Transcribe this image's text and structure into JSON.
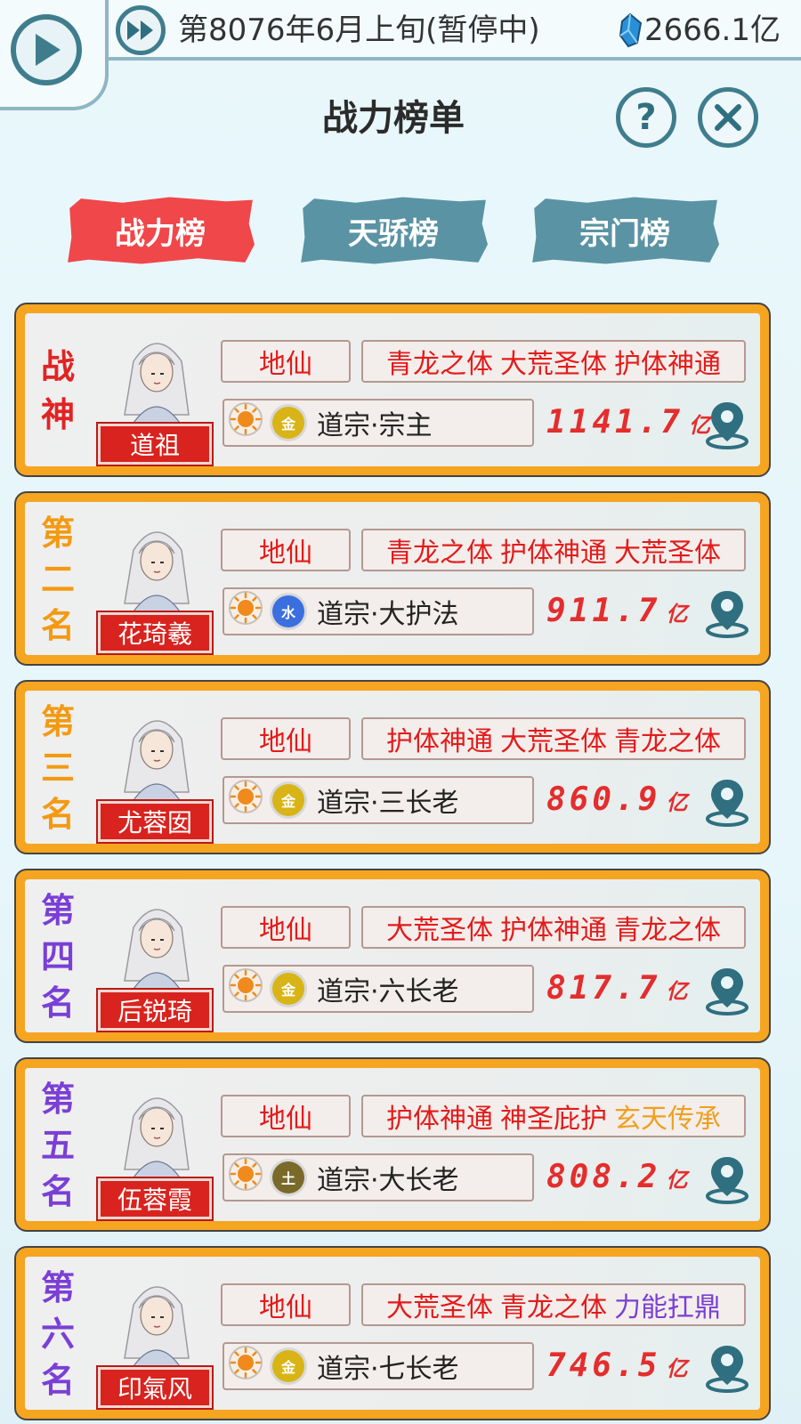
{
  "header": {
    "date": "第8076年6月上旬(暂停中)",
    "currency": "2666.1亿",
    "title": "战力榜单"
  },
  "tabs": [
    {
      "label": "战力榜",
      "active": true
    },
    {
      "label": "天骄榜",
      "active": false
    },
    {
      "label": "宗门榜",
      "active": false
    }
  ],
  "colors": {
    "gold_rank": "#f6a521",
    "purple_rank": "#7a3fd6",
    "red": "#e31b1b",
    "teal": "#3f7d8d"
  },
  "entries": [
    {
      "rank": [
        "战",
        "神"
      ],
      "rank_color": "#e02424",
      "name": "道祖",
      "realm": "地仙",
      "traits": [
        {
          "text": "青龙之体",
          "color": "#e31b1b"
        },
        {
          "text": "大荒圣体",
          "color": "#e31b1b"
        },
        {
          "text": "护体神通",
          "color": "#e31b1b"
        }
      ],
      "element": "金",
      "element_color": "#d9b416",
      "role": "道宗·宗主",
      "power": "1141.7",
      "unit": "亿"
    },
    {
      "rank": [
        "第",
        "二",
        "名"
      ],
      "rank_color": "#f39a12",
      "name": "花琦羲",
      "realm": "地仙",
      "traits": [
        {
          "text": "青龙之体",
          "color": "#e31b1b"
        },
        {
          "text": "护体神通",
          "color": "#e31b1b"
        },
        {
          "text": "大荒圣体",
          "color": "#e31b1b"
        }
      ],
      "element": "水",
      "element_color": "#3b6fe0",
      "role": "道宗·大护法",
      "power": "911.7",
      "unit": "亿"
    },
    {
      "rank": [
        "第",
        "三",
        "名"
      ],
      "rank_color": "#f39a12",
      "name": "尤蓉囡",
      "realm": "地仙",
      "traits": [
        {
          "text": "护体神通",
          "color": "#e31b1b"
        },
        {
          "text": "大荒圣体",
          "color": "#e31b1b"
        },
        {
          "text": "青龙之体",
          "color": "#e31b1b"
        }
      ],
      "element": "金",
      "element_color": "#d9b416",
      "role": "道宗·三长老",
      "power": "860.9",
      "unit": "亿"
    },
    {
      "rank": [
        "第",
        "四",
        "名"
      ],
      "rank_color": "#7a3fd6",
      "name": "后锐琦",
      "realm": "地仙",
      "traits": [
        {
          "text": "大荒圣体",
          "color": "#e31b1b"
        },
        {
          "text": "护体神通",
          "color": "#e31b1b"
        },
        {
          "text": "青龙之体",
          "color": "#e31b1b"
        }
      ],
      "element": "金",
      "element_color": "#d9b416",
      "role": "道宗·六长老",
      "power": "817.7",
      "unit": "亿"
    },
    {
      "rank": [
        "第",
        "五",
        "名"
      ],
      "rank_color": "#7a3fd6",
      "name": "伍蓉霞",
      "realm": "地仙",
      "traits": [
        {
          "text": "护体神通",
          "color": "#e31b1b"
        },
        {
          "text": "神圣庇护",
          "color": "#e31b1b"
        },
        {
          "text": "玄天传承",
          "color": "#f0a020"
        }
      ],
      "element": "土",
      "element_color": "#7a6a2a",
      "role": "道宗·大长老",
      "power": "808.2",
      "unit": "亿"
    },
    {
      "rank": [
        "第",
        "六",
        "名"
      ],
      "rank_color": "#7a3fd6",
      "name": "印氣风",
      "realm": "地仙",
      "traits": [
        {
          "text": "大荒圣体",
          "color": "#e31b1b"
        },
        {
          "text": "青龙之体",
          "color": "#e31b1b"
        },
        {
          "text": "力能扛鼎",
          "color": "#7a3fd6"
        }
      ],
      "element": "金",
      "element_color": "#d9b416",
      "role": "道宗·七长老",
      "power": "746.5",
      "unit": "亿"
    }
  ]
}
